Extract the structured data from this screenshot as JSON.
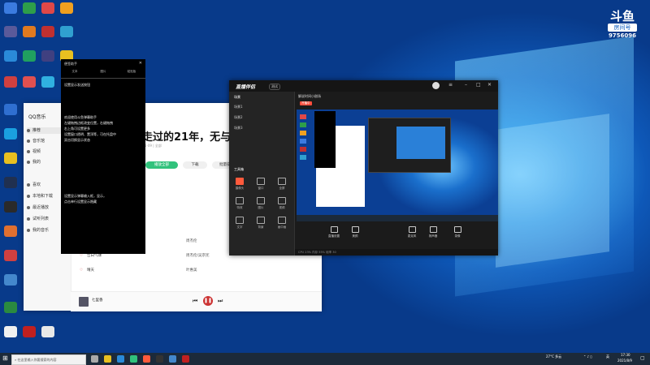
{
  "overlay": {
    "logo_main": "斗鱼",
    "logo_sub": "房间号",
    "room_number": "9756096"
  },
  "qqmusic": {
    "logo": "QQ音乐",
    "nav": [
      "推荐",
      "音乐馆",
      "视频",
      "我的",
      "喜欢",
      "本地和下载",
      "最近播放",
      "试听列表",
      "我的音乐"
    ],
    "song_title": "周杰伦走过的21年，无与",
    "song_sub": "\"周杰伦\" 公开专辑 2021-09 | 全部",
    "btn_play": "播放全部",
    "btn_download": "下载",
    "btn_batch": "批量操作",
    "rows": [
      {
        "name": "等你下课(with 杨瑞代)",
        "tags": "SQ MV",
        "artist": "周杰伦"
      },
      {
        "name": "告白气球",
        "tags": "SQ MV",
        "artist": "周杰伦/吴宗宪"
      },
      {
        "name": "晴天",
        "tags": "SQ MV",
        "artist": "叶惠美"
      }
    ],
    "player_song": "七里香"
  },
  "notes": {
    "title": "便签助手",
    "tabs": [
      "文本",
      "图片",
      "粘贴板"
    ],
    "lines": [
      "设置显示发送按钮",
      "欢迎使用斗鱼弹幕助手",
      "左键拖拽边框改变位置，右键拖拽",
      "右上角可设置更多",
      "设置窗口透明、置顶等，可在托盘中",
      "双击切换显示状态",
      "设置显示弹幕输入框，显示，",
      "点击单行设置显示隐藏"
    ]
  },
  "capture": {
    "brand": "直播伴侣",
    "version": "测试",
    "stream_title": "解说时间小剧场",
    "live_badge": "开播中",
    "scene_header": "场景",
    "scenes": [
      "场景1",
      "场景2",
      "场景3"
    ],
    "tools_header": "工具箱",
    "tools": [
      "摄像头",
      "窗口",
      "全屏",
      "特效",
      "图片",
      "视频",
      "文字",
      "背景",
      "画中画"
    ],
    "controls": [
      "直播设置",
      "美颜",
      "麦克风",
      "扬声器",
      "录像"
    ],
    "status": "CPU 23%   内存 55%   帧率 30"
  },
  "taskbar": {
    "search_placeholder": "在这里输入你要搜索的内容",
    "weather": "27°C 多云",
    "time": "17:30",
    "date": "2021/8/9",
    "lang": "英"
  }
}
